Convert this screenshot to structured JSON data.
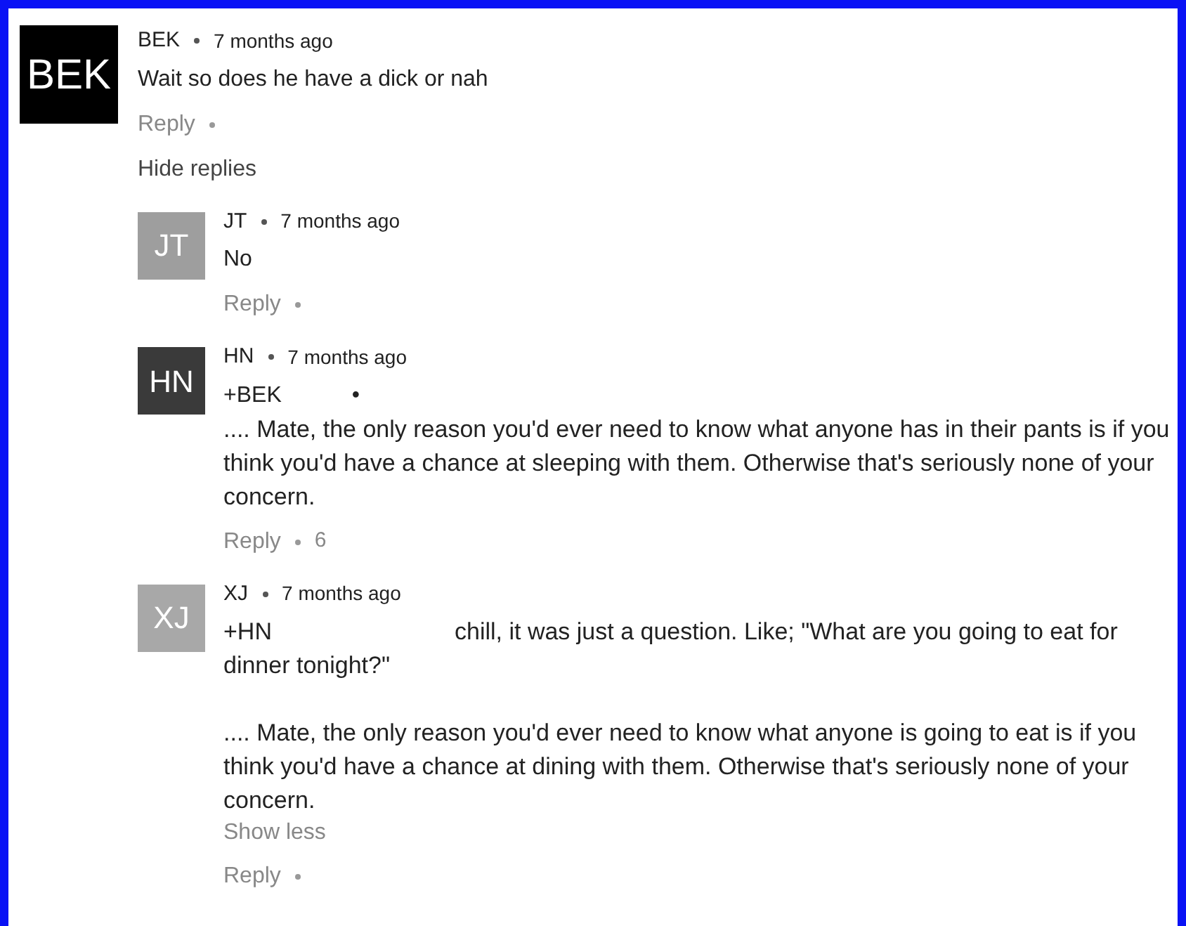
{
  "comment": {
    "avatar": "BEK",
    "color": "#000000",
    "author": "BEK",
    "time": "7 months ago",
    "text": "Wait so does he have a dick or nah",
    "reply_label": "Reply",
    "toggle": "Hide replies"
  },
  "replies": [
    {
      "avatar": "JT",
      "color": "#9e9e9e",
      "author": "JT",
      "time": "7 months ago",
      "paragraphs": [
        "No"
      ],
      "reply_label": "Reply"
    },
    {
      "avatar": "HN",
      "color": "#3a3a3a",
      "author": "HN",
      "time": "7 months ago",
      "mention": "+BEK",
      "kind": "line",
      "mention_suffix": "•",
      "paragraphs": [
        ".... Mate, the only reason you'd ever need to know what anyone has in their pants is if you think you'd have a chance at sleeping with them. Otherwise that's seriously none of your concern."
      ],
      "reply_label": "Reply",
      "likes": "6"
    },
    {
      "avatar": "XJ",
      "color": "#a8a8a8",
      "author": "XJ",
      "time": "7 months ago",
      "mention": "+HN",
      "kind": "inline",
      "paragraphs": [
        "chill, it was just a question. Like; \"What are you going to eat for dinner tonight?\"",
        ".... Mate, the only reason you'd ever need to know what anyone is going to eat is if you think you'd have a chance at dining with them. Otherwise that's seriously none of your concern."
      ],
      "show_less": "Show less",
      "reply_label": "Reply"
    }
  ]
}
